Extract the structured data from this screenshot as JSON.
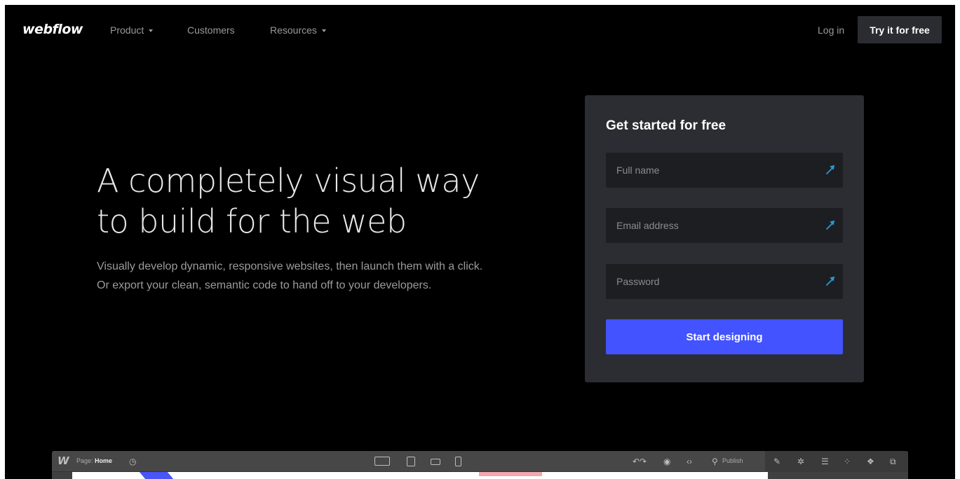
{
  "nav": {
    "logo": "webflow",
    "links": [
      {
        "label": "Product",
        "has_dropdown": true
      },
      {
        "label": "Customers",
        "has_dropdown": false
      },
      {
        "label": "Resources",
        "has_dropdown": true
      }
    ],
    "login": "Log in",
    "cta": "Try it for free"
  },
  "hero": {
    "title_line1": "A completely visual way",
    "title_line2": "to build for the web",
    "subtitle": "Visually develop dynamic, responsive websites, then launch them with a click. Or export your clean, semantic code to hand off to your developers."
  },
  "signup": {
    "title": "Get started for free",
    "fields": [
      {
        "placeholder": "Full name",
        "icon": "key-icon"
      },
      {
        "placeholder": "Email address",
        "icon": "key-icon"
      },
      {
        "placeholder": "Password",
        "icon": "key-icon"
      }
    ],
    "submit": "Start designing"
  },
  "designer": {
    "logo": "W",
    "page_prefix": "Page:",
    "page_name": "Home",
    "publish": "Publish",
    "icons": [
      "history-icon",
      "desktop-icon",
      "tablet-icon",
      "mobile-landscape-icon",
      "mobile-portrait-icon",
      "undo-redo-icon",
      "preview-icon",
      "code-icon",
      "publish-icon",
      "brush-icon",
      "settings-icon",
      "navigator-icon",
      "interactions-icon",
      "assets-icon",
      "pages-icon"
    ]
  },
  "colors": {
    "background": "#000000",
    "card": "#2c2d32",
    "input": "#1d1e22",
    "primary_button": "#4353ff",
    "key_icon": "#2a9bd6"
  }
}
